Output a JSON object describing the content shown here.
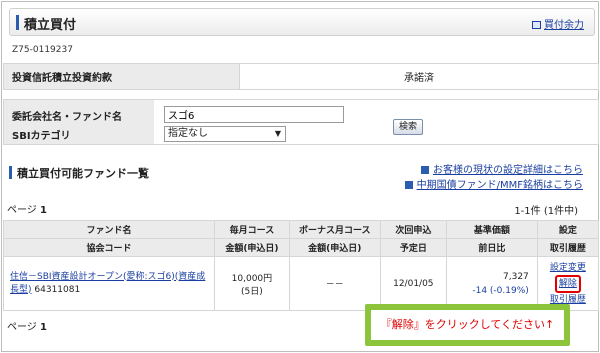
{
  "header": {
    "title": "積立買付",
    "buying_power_link": "買付余力"
  },
  "account_number": "Z75-0119237",
  "agreement": {
    "label": "投資信託積立投資約款",
    "status": "承諾済"
  },
  "search": {
    "fund_name_label": "委託会社名・ファンド名",
    "fund_name_value": "スゴ6",
    "category_label": "SBIカテゴリ",
    "category_selected": "指定なし",
    "search_button": "検索"
  },
  "fund_list": {
    "section_title": "積立買付可能ファンド一覧",
    "links": [
      "お客様の現状の設定詳細はこちら",
      "中期国債ファンド/MMF銘柄はこちら"
    ],
    "page_label": "ページ",
    "page_number": "1",
    "result_count": "1-1件 (1件中)",
    "columns": {
      "fund_top": "ファンド名",
      "fund_bottom": "協会コード",
      "monthly_top": "毎月コース",
      "monthly_bottom": "金額(申込日)",
      "bonus_top": "ボーナス月コース",
      "bonus_bottom": "金額(申込日)",
      "next_top": "次回申込",
      "next_bottom": "予定日",
      "nav_top": "基準価額",
      "nav_bottom": "前日比",
      "settings_top": "設定",
      "settings_bottom": "取引履歴"
    },
    "rows": [
      {
        "fund_name": "住信－SBI資産設計オープン(愛称:スゴ6)(資産成長型)",
        "code": "64311081",
        "monthly_amount": "10,000円",
        "monthly_day": "(5日)",
        "bonus": "－－",
        "next_date": "12/01/05",
        "nav": "7,327",
        "change": "-14 (-0.19%)",
        "change_link": "設定変更",
        "cancel_link": "解除",
        "history_link": "取引履歴"
      }
    ]
  },
  "callout": "『解除』をクリックしてください↑",
  "colors": {
    "accent": "#2a5db0",
    "link": "#1a3fa0",
    "highlight": "#e00000",
    "callout_border": "#8cc43c"
  }
}
